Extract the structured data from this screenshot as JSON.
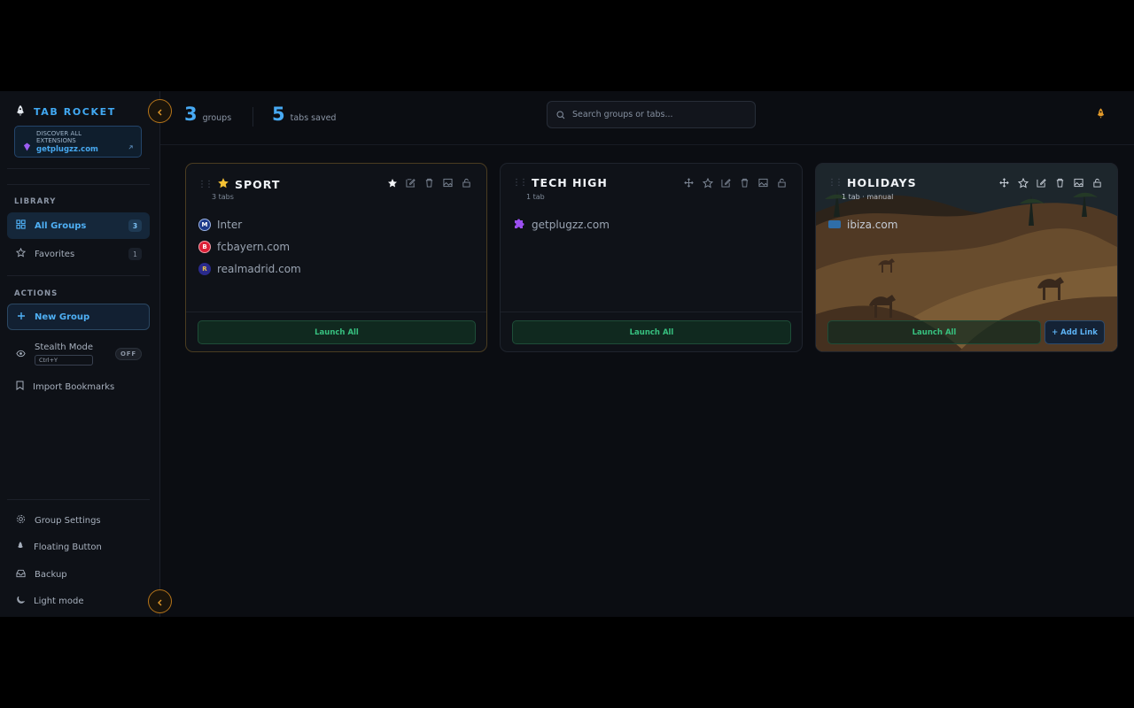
{
  "sidebar": {
    "brand": "TAB ROCKET",
    "promo": {
      "line1": "DISCOVER ALL EXTENSIONS",
      "url": "getplugzz.com"
    },
    "library_label": "LIBRARY",
    "library_items": [
      {
        "label": "All Groups",
        "count": "3"
      },
      {
        "label": "Favorites",
        "count": "1"
      }
    ],
    "actions_label": "ACTIONS",
    "new_group": "New Group",
    "stealth": {
      "label": "Stealth Mode",
      "shortcut": "Ctrl+Y",
      "state": "OFF"
    },
    "import_bookmarks": "Import Bookmarks",
    "bottom_items": [
      "Group Settings",
      "Floating Button",
      "Backup",
      "Light mode"
    ]
  },
  "header": {
    "groups_count": "3",
    "groups_label": "groups",
    "tabs_count": "5",
    "tabs_label": "tabs saved",
    "search_placeholder": "Search groups or tabs..."
  },
  "groups": [
    {
      "title": "SPORT",
      "subtitle": "3 tabs",
      "favorite": true,
      "links": [
        "Inter",
        "fcbayern.com",
        "realmadrid.com"
      ],
      "launch_label": "Launch All"
    },
    {
      "title": "TECH HIGH",
      "subtitle": "1 tab",
      "favorite": false,
      "links": [
        "getplugzz.com"
      ],
      "launch_label": "Launch All"
    },
    {
      "title": "HOLIDAYS",
      "subtitle": "1 tab · manual",
      "favorite": false,
      "links": [
        "ibiza.com"
      ],
      "launch_label": "Launch All",
      "add_link_label": "+ Add Link"
    }
  ],
  "colors": {
    "accent": "#41a9f3",
    "launch": "#37c07f",
    "warning": "#e39a2a"
  }
}
